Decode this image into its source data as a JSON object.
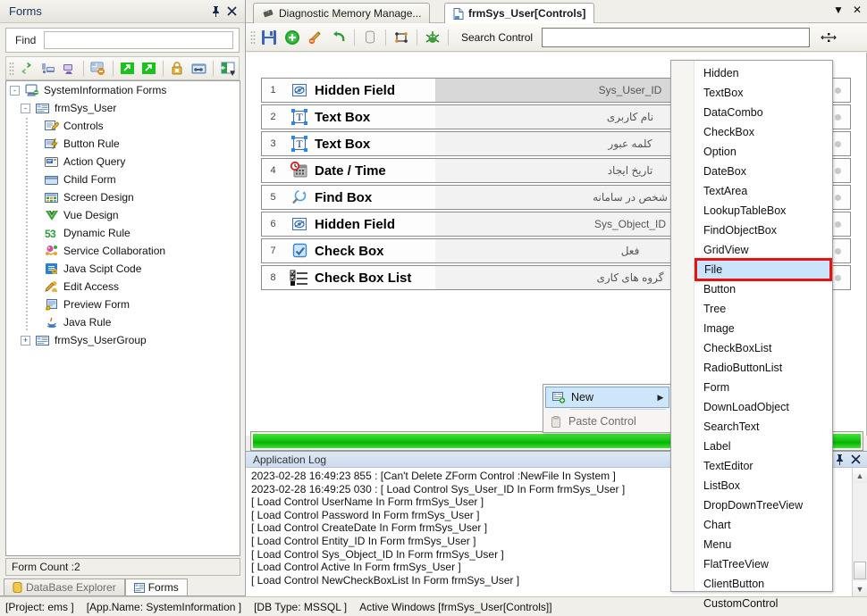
{
  "left_panel": {
    "caption": "Forms",
    "pin_icon": "pin-icon",
    "close_icon": "close-icon",
    "find_label": "Find",
    "find_value": "",
    "find_placeholder": "",
    "toolbar": [
      {
        "name": "refresh-icon",
        "title": "Refresh"
      },
      {
        "name": "server-import-icon",
        "title": "Import"
      },
      {
        "name": "server-export-icon",
        "title": "Export"
      },
      {
        "name": "form-delete-icon",
        "title": "Delete Form"
      },
      {
        "name": "export-green-icon",
        "title": "Export Form"
      },
      {
        "name": "export-green2-icon",
        "title": "Export All"
      },
      {
        "name": "lock-icon",
        "title": "Lock"
      },
      {
        "name": "window-link-icon",
        "title": "Link"
      },
      {
        "name": "panel-icon",
        "title": "Panel"
      }
    ],
    "overflow_icon": "chevron-down-icon",
    "tree": [
      {
        "label": "SystemInformation Forms",
        "level": 0,
        "expander": "-",
        "icon": "system-forms-icon"
      },
      {
        "label": "frmSys_User",
        "level": 1,
        "expander": "-",
        "icon": "form-icon"
      },
      {
        "label": "Controls",
        "level": 2,
        "expander": "",
        "icon": "controls-icon"
      },
      {
        "label": "Button Rule",
        "level": 2,
        "expander": "",
        "icon": "button-rule-icon"
      },
      {
        "label": "Action Query",
        "level": 2,
        "expander": "",
        "icon": "action-query-icon"
      },
      {
        "label": "Child Form",
        "level": 2,
        "expander": "",
        "icon": "child-form-icon"
      },
      {
        "label": "Screen Design",
        "level": 2,
        "expander": "",
        "icon": "screen-design-icon"
      },
      {
        "label": "Vue Design",
        "level": 2,
        "expander": "",
        "icon": "vue-design-icon"
      },
      {
        "label": "Dynamic Rule",
        "level": 2,
        "expander": "",
        "icon": "dynamic-rule-icon"
      },
      {
        "label": "Service Collaboration",
        "level": 2,
        "expander": "",
        "icon": "service-collaboration-icon"
      },
      {
        "label": "Java Scipt Code",
        "level": 2,
        "expander": "",
        "icon": "javascript-code-icon"
      },
      {
        "label": "Edit Access",
        "level": 2,
        "expander": "",
        "icon": "edit-access-icon"
      },
      {
        "label": "Preview Form",
        "level": 2,
        "expander": "",
        "icon": "preview-form-icon"
      },
      {
        "label": "Java Rule",
        "level": 2,
        "expander": "",
        "icon": "java-rule-icon"
      },
      {
        "label": "frmSys_UserGroup",
        "level": 1,
        "expander": "+",
        "icon": "form-icon"
      }
    ],
    "form_count": "Form Count :2",
    "tabs": [
      {
        "label": "DataBase Explorer",
        "icon": "database-icon",
        "selected": false
      },
      {
        "label": "Forms",
        "icon": "forms-icon",
        "selected": true
      }
    ]
  },
  "main": {
    "tabs": [
      {
        "label": "Diagnostic Memory Manage...",
        "icon": "memory-chip-icon",
        "selected": false
      },
      {
        "label": "frmSys_User[Controls]",
        "icon": "document-icon",
        "selected": true
      }
    ],
    "tab_menu_icon": "chevron-down-icon",
    "tab_close_icon": "close-icon",
    "toolbar": [
      {
        "name": "save-icon",
        "title": "Save"
      },
      {
        "name": "add-icon",
        "title": "Add"
      },
      {
        "name": "edit-icon",
        "title": "Edit"
      },
      {
        "name": "undo-icon",
        "title": "Undo"
      },
      {
        "name": "database-cylinder-icon",
        "title": "Database"
      },
      {
        "name": "mapping-icon",
        "title": "Mapping"
      },
      {
        "name": "bug-icon",
        "title": "Debug"
      }
    ],
    "search_label": "Search Control",
    "search_value": "",
    "search_placeholder": "",
    "layout_icon": "move-handles-icon",
    "controls": [
      {
        "num": "1",
        "type": "Hidden Field",
        "desc": "Sys_User_ID",
        "icon": "hidden-field-icon",
        "selected": true
      },
      {
        "num": "2",
        "type": "Text Box",
        "desc": "نام کاربری",
        "icon": "textbox-icon",
        "selected": false
      },
      {
        "num": "3",
        "type": "Text Box",
        "desc": "کلمه عبور",
        "icon": "textbox-icon",
        "selected": false
      },
      {
        "num": "4",
        "type": "Date / Time",
        "desc": "تاریخ ایجاد",
        "icon": "datetime-icon",
        "selected": false
      },
      {
        "num": "5",
        "type": "Find Box",
        "desc": "شخص در سامانه",
        "icon": "find-box-icon",
        "selected": false
      },
      {
        "num": "6",
        "type": "Hidden Field",
        "desc": "Sys_Object_ID",
        "icon": "hidden-field-icon",
        "selected": false
      },
      {
        "num": "7",
        "type": "Check Box",
        "desc": "فعل",
        "icon": "checkbox-icon",
        "selected": false
      },
      {
        "num": "8",
        "type": "Check Box List",
        "desc": "گروه های کاری",
        "icon": "checkbox-list-icon",
        "selected": false
      }
    ],
    "progress_percent": 100,
    "progress_color": "#17c512"
  },
  "context_menu": {
    "items": [
      {
        "label": "New",
        "icon": "new-control-icon",
        "selected": true,
        "has_submenu": true,
        "disabled": false
      },
      {
        "label": "Paste Control",
        "icon": "paste-icon",
        "selected": false,
        "has_submenu": false,
        "disabled": true
      }
    ],
    "submenu_arrow": "chevron-right-icon"
  },
  "type_menu": {
    "highlight_color": "#e8120f",
    "items": [
      {
        "label": "Hidden",
        "highlighted": false
      },
      {
        "label": "TextBox",
        "highlighted": false
      },
      {
        "label": "DataCombo",
        "highlighted": false
      },
      {
        "label": "CheckBox",
        "highlighted": false
      },
      {
        "label": "Option",
        "highlighted": false
      },
      {
        "label": "DateBox",
        "highlighted": false
      },
      {
        "label": "TextArea",
        "highlighted": false
      },
      {
        "label": "LookupTableBox",
        "highlighted": false
      },
      {
        "label": "FindObjectBox",
        "highlighted": false
      },
      {
        "label": "GridView",
        "highlighted": false
      },
      {
        "label": "File",
        "highlighted": true
      },
      {
        "label": "Button",
        "highlighted": false
      },
      {
        "label": "Tree",
        "highlighted": false
      },
      {
        "label": "Image",
        "highlighted": false
      },
      {
        "label": "CheckBoxList",
        "highlighted": false
      },
      {
        "label": "RadioButtonList",
        "highlighted": false
      },
      {
        "label": "Form",
        "highlighted": false
      },
      {
        "label": "DownLoadObject",
        "highlighted": false
      },
      {
        "label": "SearchText",
        "highlighted": false
      },
      {
        "label": "Label",
        "highlighted": false
      },
      {
        "label": "TextEditor",
        "highlighted": false
      },
      {
        "label": "ListBox",
        "highlighted": false
      },
      {
        "label": "DropDownTreeView",
        "highlighted": false
      },
      {
        "label": "Chart",
        "highlighted": false
      },
      {
        "label": "Menu",
        "highlighted": false
      },
      {
        "label": "FlatTreeView",
        "highlighted": false
      },
      {
        "label": "ClientButton",
        "highlighted": false
      },
      {
        "label": "CustomControl",
        "highlighted": false
      }
    ]
  },
  "log_panel": {
    "caption": "Application Log",
    "pin_icon": "pin-icon",
    "close_icon": "close-icon",
    "lines": [
      "2023-02-28 16:49:23 855 :  [Can't Delete ZForm Control :NewFile In System ]",
      "2023-02-28 16:49:25 030 :  [ Load Control Sys_User_ID In Form frmSys_User ]",
      "[ Load Control UserName In  Form frmSys_User ]",
      "[ Load Control Password In  Form frmSys_User ]",
      "[ Load Control CreateDate In  Form frmSys_User ]",
      "[ Load Control Entity_ID In  Form frmSys_User ]",
      "[ Load Control Sys_Object_ID In  Form frmSys_User ]",
      "[ Load Control Active In  Form frmSys_User ]",
      "[ Load Control NewCheckBoxList In  Form frmSys_User ]"
    ]
  },
  "status_bar": {
    "project": "[Project: ems ]",
    "app_name": "[App.Name: SystemInformation ]",
    "db_type": "[DB Type: MSSQL ]",
    "active_windows": "Active Windows [frmSys_User[Controls]]"
  }
}
